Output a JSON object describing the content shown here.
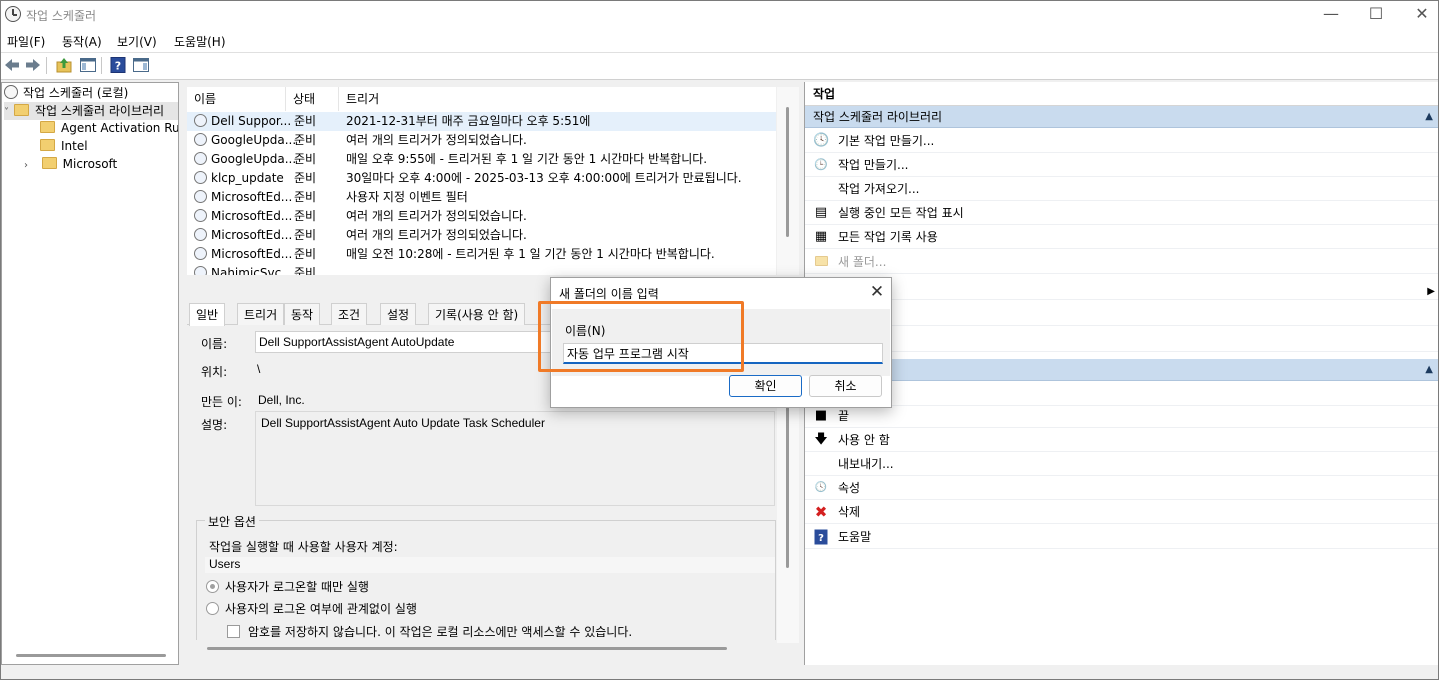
{
  "window": {
    "title": "작업 스케줄러",
    "minimize": "—",
    "maximize": "☐",
    "close": "✕"
  },
  "menu": [
    "파일(F)",
    "동작(A)",
    "보기(V)",
    "도움말(H)"
  ],
  "tree": {
    "root": "작업 스케줄러 (로컬)",
    "library": "작업 스케줄러 라이브러리",
    "children": [
      "Agent Activation Run",
      "Intel",
      "Microsoft"
    ]
  },
  "task_table": {
    "columns": [
      "이름",
      "상태",
      "트리거"
    ],
    "rows": [
      {
        "name": "Dell Suppor...",
        "status": "준비",
        "trigger": "2021-12-31부터 매주 금요일마다 오후 5:51에"
      },
      {
        "name": "GoogleUpda...",
        "status": "준비",
        "trigger": "여러 개의 트리거가 정의되었습니다."
      },
      {
        "name": "GoogleUpda...",
        "status": "준비",
        "trigger": "매일 오후 9:55에 - 트리거된 후 1 일 기간 동안 1 시간마다 반복합니다."
      },
      {
        "name": "klcp_update",
        "status": "준비",
        "trigger": "30일마다 오후 4:00에 - 2025-03-13 오후 4:00:00에 트리거가 만료됩니다."
      },
      {
        "name": "MicrosoftEd...",
        "status": "준비",
        "trigger": "사용자 지정 이벤트 필터"
      },
      {
        "name": "MicrosoftEd...",
        "status": "준비",
        "trigger": "여러 개의 트리거가 정의되었습니다."
      },
      {
        "name": "MicrosoftEd...",
        "status": "준비",
        "trigger": "여러 개의 트리거가 정의되었습니다."
      },
      {
        "name": "MicrosoftEd...",
        "status": "준비",
        "trigger": "매일 오전 10:28에 - 트리거된 후 1 일 기간 동안 1 시간마다 반복합니다."
      },
      {
        "name": "NahimicSvc...",
        "status": "준비",
        "trigger": ""
      }
    ]
  },
  "details": {
    "tabs": [
      "일반",
      "트리거",
      "동작",
      "조건",
      "설정",
      "기록(사용 안 함)"
    ],
    "name_label": "이름:",
    "name_value": "Dell SupportAssistAgent AutoUpdate",
    "location_label": "위치:",
    "location_value": "\\",
    "author_label": "만든 이:",
    "author_value": "Dell, Inc.",
    "desc_label": "설명:",
    "desc_value": "Dell SupportAssistAgent Auto Update Task Scheduler",
    "security_title": "보안 옵션",
    "run_as_label": "작업을 실행할 때 사용할 사용자 계정:",
    "run_as_value": "Users",
    "radio_logged_on": "사용자가 로그온할 때만 실행",
    "radio_whether": "사용자의 로그온 여부에 관계없이 실행",
    "checkbox_no_password": "암호를 저장하지 않습니다. 이 작업은 로컬 리소스에만 액세스할 수 있습니다."
  },
  "actions": {
    "header": "작업",
    "section1": "작업 스케줄러 라이브러리",
    "items1": [
      {
        "label": "기본 작업 만들기...",
        "icon": "basic-task-icon",
        "disabled": false
      },
      {
        "label": "작업 만들기...",
        "icon": "create-task-icon",
        "disabled": false
      },
      {
        "label": "작업 가져오기...",
        "icon": "",
        "disabled": false
      },
      {
        "label": "실행 중인 모든 작업 표시",
        "icon": "running-tasks-icon",
        "disabled": false
      },
      {
        "label": "모든 작업 기록 사용",
        "icon": "history-icon",
        "disabled": false
      },
      {
        "label": "새 폴더...",
        "icon": "new-folder-icon",
        "disabled": true
      }
    ],
    "items2": [
      {
        "label": "끝",
        "icon": "end-icon"
      },
      {
        "label": "사용 안 함",
        "icon": "disable-icon"
      },
      {
        "label": "내보내기...",
        "icon": ""
      },
      {
        "label": "속성",
        "icon": "properties-icon"
      },
      {
        "label": "삭제",
        "icon": "delete-icon"
      },
      {
        "label": "도움말",
        "icon": "help-icon"
      }
    ]
  },
  "dialog": {
    "title": "새 폴더의 이름 입력",
    "close": "✕",
    "field_label": "이름(N)",
    "field_value": "자동 업무 프로그램 시작",
    "ok": "확인",
    "cancel": "취소"
  },
  "colors": {
    "highlight": "#f07a27",
    "section_bg": "#c9dbee",
    "input_accent": "#1565c0"
  }
}
